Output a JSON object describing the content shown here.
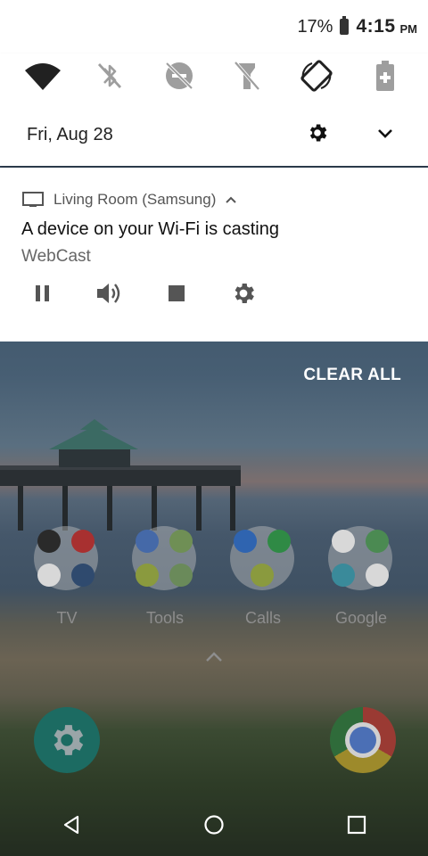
{
  "status_bar": {
    "battery_percent": "17%",
    "time": "4:15",
    "time_suffix": "PM"
  },
  "quick_settings": {
    "tiles": [
      {
        "name": "wifi",
        "icon": "wifi-icon",
        "active": true
      },
      {
        "name": "bluetooth",
        "icon": "bluetooth-off-icon",
        "active": false
      },
      {
        "name": "do-not-disturb",
        "icon": "dnd-off-icon",
        "active": false
      },
      {
        "name": "flashlight",
        "icon": "flashlight-off-icon",
        "active": false
      },
      {
        "name": "auto-rotate",
        "icon": "auto-rotate-icon",
        "active": true
      },
      {
        "name": "battery-saver",
        "icon": "battery-saver-icon",
        "active": false
      }
    ],
    "date": "Fri, Aug 28"
  },
  "notification": {
    "device": "Living Room (Samsung)",
    "title": "A device on your Wi-Fi is casting",
    "app": "WebCast",
    "actions": [
      "pause-icon",
      "volume-icon",
      "stop-icon",
      "settings-icon"
    ]
  },
  "clear_all_label": "CLEAR ALL",
  "home": {
    "folders": [
      {
        "label": "TV"
      },
      {
        "label": "Tools"
      },
      {
        "label": "Calls"
      },
      {
        "label": "Google"
      }
    ]
  },
  "colors": {
    "accent_dark": "#212121",
    "icon_inactive": "#9e9e9e",
    "notification_bg": "#ffffff"
  }
}
